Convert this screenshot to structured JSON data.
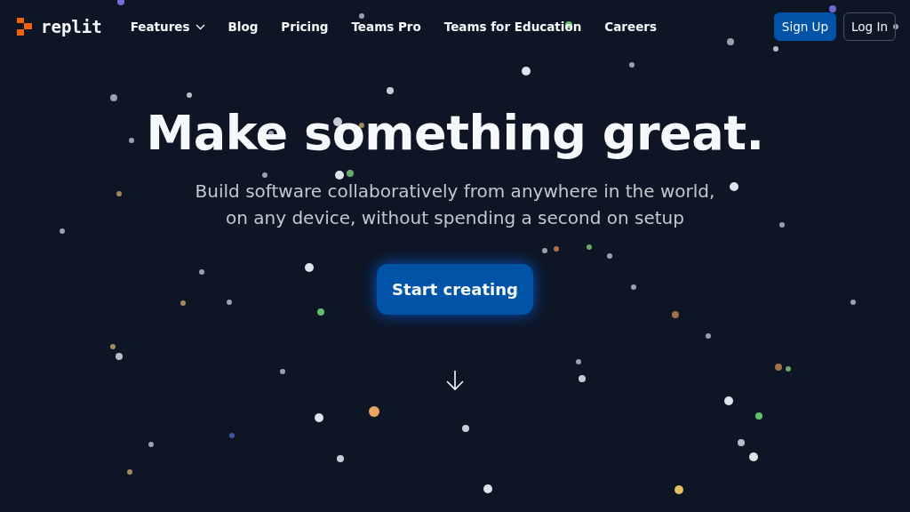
{
  "logo": {
    "text": "replit"
  },
  "nav": [
    {
      "label": "Features",
      "dropdown": true
    },
    {
      "label": "Blog",
      "dropdown": false
    },
    {
      "label": "Pricing",
      "dropdown": false
    },
    {
      "label": "Teams Pro",
      "dropdown": false
    },
    {
      "label": "Teams for Education",
      "dropdown": false
    },
    {
      "label": "Careers",
      "dropdown": false
    }
  ],
  "auth_buttons": [
    {
      "label": "Sign Up",
      "kind": "primary"
    },
    {
      "label": "Log In",
      "kind": "outline"
    }
  ],
  "hero": {
    "title": "Make something great.",
    "subtitle_lines": [
      "Build software collaboratively from anywhere in the world,",
      "on any device, without spending a second on setup"
    ],
    "cta": "Start creating"
  }
}
